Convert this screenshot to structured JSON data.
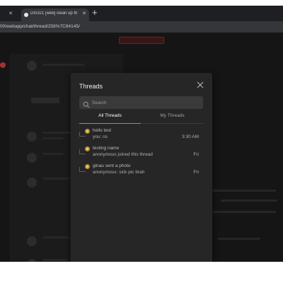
{
  "browser": {
    "active_tab_title": "DI0321 [web] clean up th",
    "url": "00/webapp/chat/thread/258%7C84145/"
  },
  "modal": {
    "title": "Threads",
    "search_placeholder": "Search",
    "tabs": [
      {
        "label": "All Threads",
        "active": true
      },
      {
        "label": "My Threads",
        "active": false
      }
    ],
    "threads": [
      {
        "name": "hello test",
        "preview": "you: os",
        "time": "3:30 AM"
      },
      {
        "name": "testing name",
        "preview": "anonymous joined this thread",
        "time": "Fri"
      },
      {
        "name": "ginau sent a photo",
        "preview": "anonymous: sick pic brah",
        "time": "Fri"
      }
    ]
  },
  "colors": {
    "modal_bg": "#262626",
    "accent_underline": "#8a7fd8",
    "avatar": "#b7933a"
  }
}
